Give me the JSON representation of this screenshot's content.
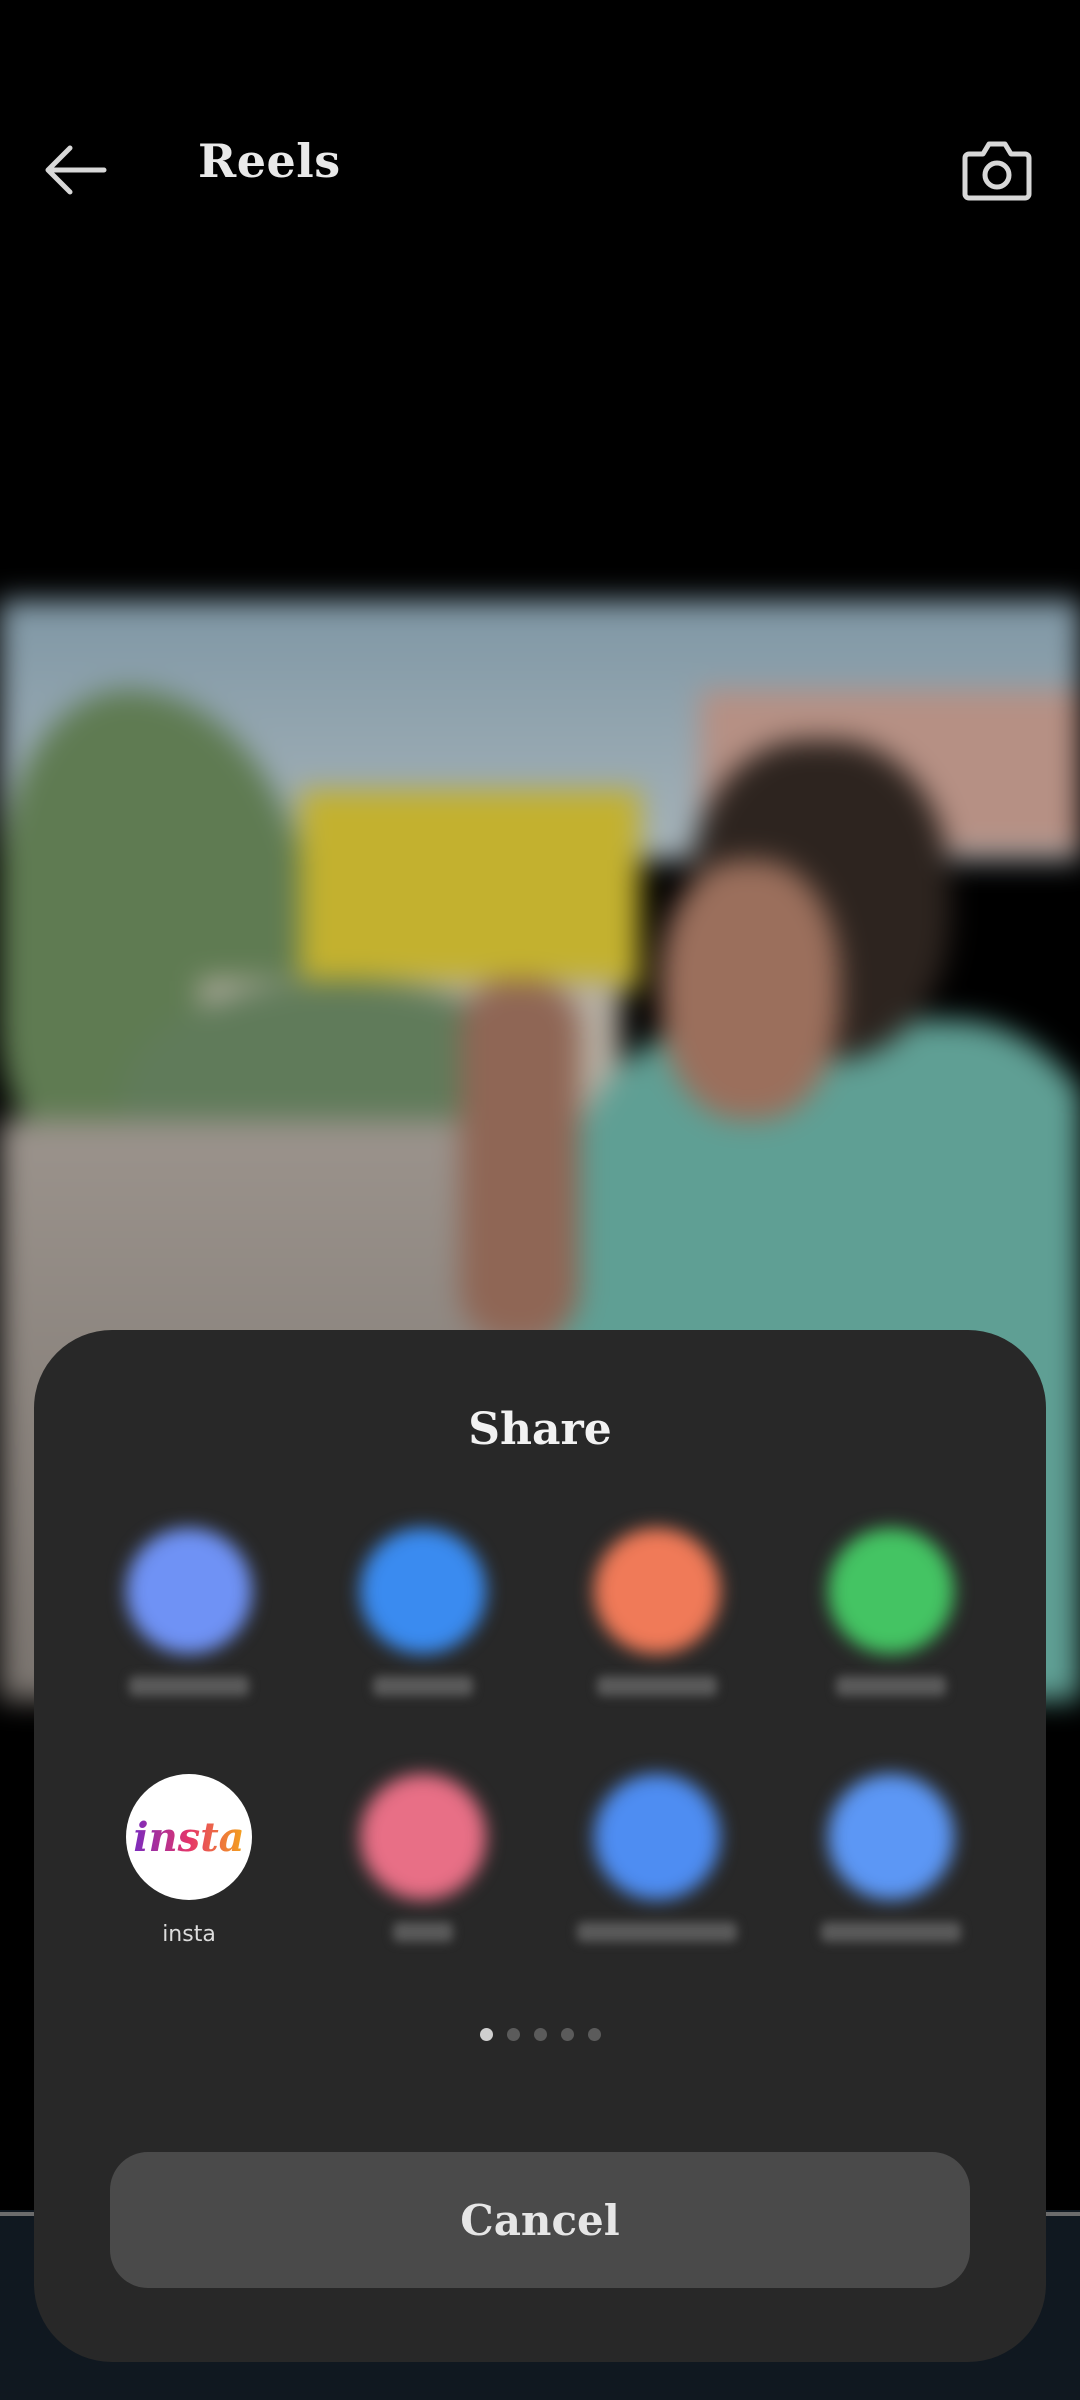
{
  "header": {
    "title": "Reels",
    "back_icon": "arrow-left-icon",
    "camera_icon": "camera-icon"
  },
  "share_sheet": {
    "title": "Share",
    "apps": [
      {
        "label": "",
        "color": "#6f92f5",
        "visible_label": false
      },
      {
        "label": "",
        "color": "#3a8bf0",
        "visible_label": false
      },
      {
        "label": "",
        "color": "#f07a58",
        "visible_label": false
      },
      {
        "label": "",
        "color": "#44c463",
        "visible_label": false
      },
      {
        "label": "insta",
        "logo_text": "insta",
        "color": "#ffffff",
        "visible_label": true
      },
      {
        "label": "",
        "color": "#e86f86",
        "visible_label": false
      },
      {
        "label": "",
        "color": "#4e8df2",
        "visible_label": false
      },
      {
        "label": "",
        "color": "#5c97f5",
        "visible_label": false
      }
    ],
    "page_indicator": {
      "current": 1,
      "total": 5
    },
    "cancel_label": "Cancel"
  },
  "colors": {
    "sheet_bg": "#282828",
    "cancel_bg": "#4a4a4a",
    "background": "#000000"
  }
}
